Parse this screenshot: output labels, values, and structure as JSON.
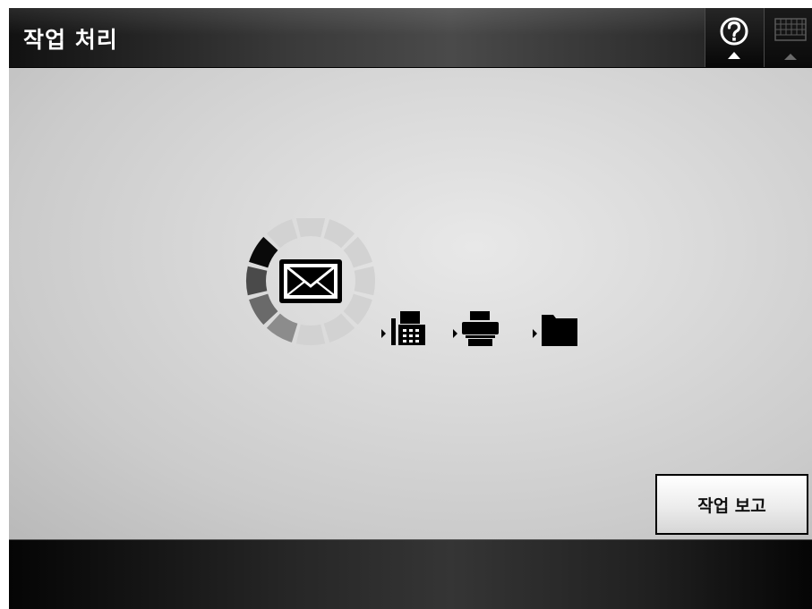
{
  "window": {
    "title": "작업 처리"
  },
  "toolbar": {
    "help_icon": "help-circle-icon",
    "keyboard_icon": "keyboard-icon"
  },
  "status_animation": {
    "active_icon": "envelope-icon",
    "steps": [
      "fax-icon",
      "printer-icon",
      "folder-icon"
    ],
    "spinner_segments": 12,
    "spinner_dark_segments": 4
  },
  "actions": {
    "report_label": "작업 보고"
  },
  "colors": {
    "bar_dark": "#1a1a1a",
    "content_bg": "#d4d4d4",
    "icon_black": "#000000"
  }
}
